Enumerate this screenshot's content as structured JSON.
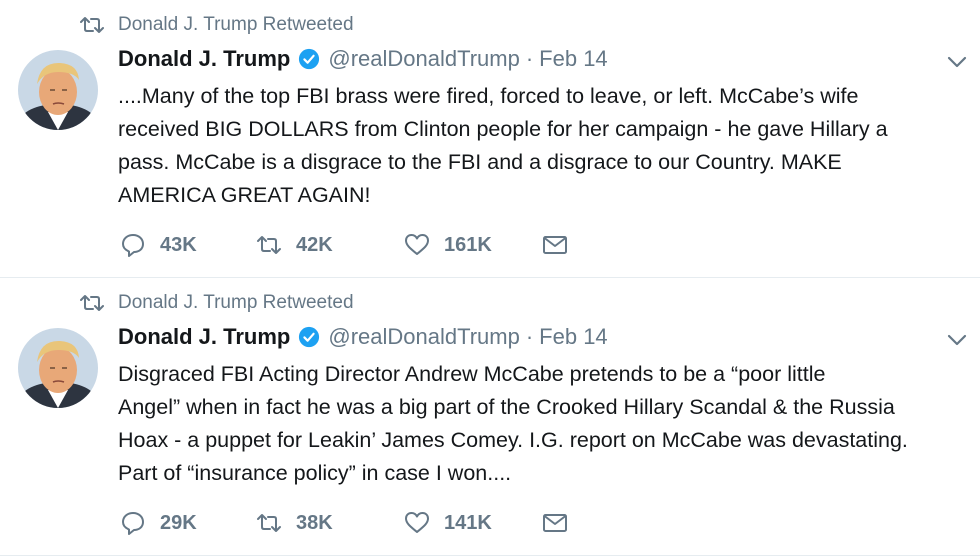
{
  "tweets": [
    {
      "retweet_context": "Donald J. Trump Retweeted",
      "name": "Donald J. Trump",
      "handle": "@realDonaldTrump",
      "separator": "·",
      "date": "Feb 14",
      "lines": [
        "....Many of the top FBI brass were fired, forced to leave, or left. McCabe’s wife",
        "received BIG DOLLARS from Clinton people for her campaign - he gave Hillary a",
        "pass. McCabe is a disgrace to the FBI and a disgrace to our Country. MAKE",
        "AMERICA GREAT AGAIN!"
      ],
      "replies": "43K",
      "retweets": "42K",
      "likes": "161K"
    },
    {
      "retweet_context": "Donald J. Trump Retweeted",
      "name": "Donald J. Trump",
      "handle": "@realDonaldTrump",
      "separator": "·",
      "date": "Feb 14",
      "lines": [
        "Disgraced FBI Acting Director Andrew McCabe pretends to be a “poor little",
        "Angel” when in fact he was a big part of the Crooked Hillary Scandal & the Russia",
        "Hoax - a puppet for Leakin’ James Comey. I.G. report on McCabe was devastating.",
        "Part of “insurance policy” in case I won...."
      ],
      "replies": "29K",
      "retweets": "38K",
      "likes": "141K"
    }
  ],
  "icons": {
    "retweet": "retweet-icon",
    "verified": "verified-badge-icon",
    "caret": "chevron-down-icon",
    "reply": "reply-icon",
    "like": "heart-icon",
    "dm": "envelope-icon"
  },
  "colors": {
    "text": "#14171a",
    "secondary": "#657786",
    "verified": "#1da1f2",
    "divider": "#e6ecf0"
  }
}
